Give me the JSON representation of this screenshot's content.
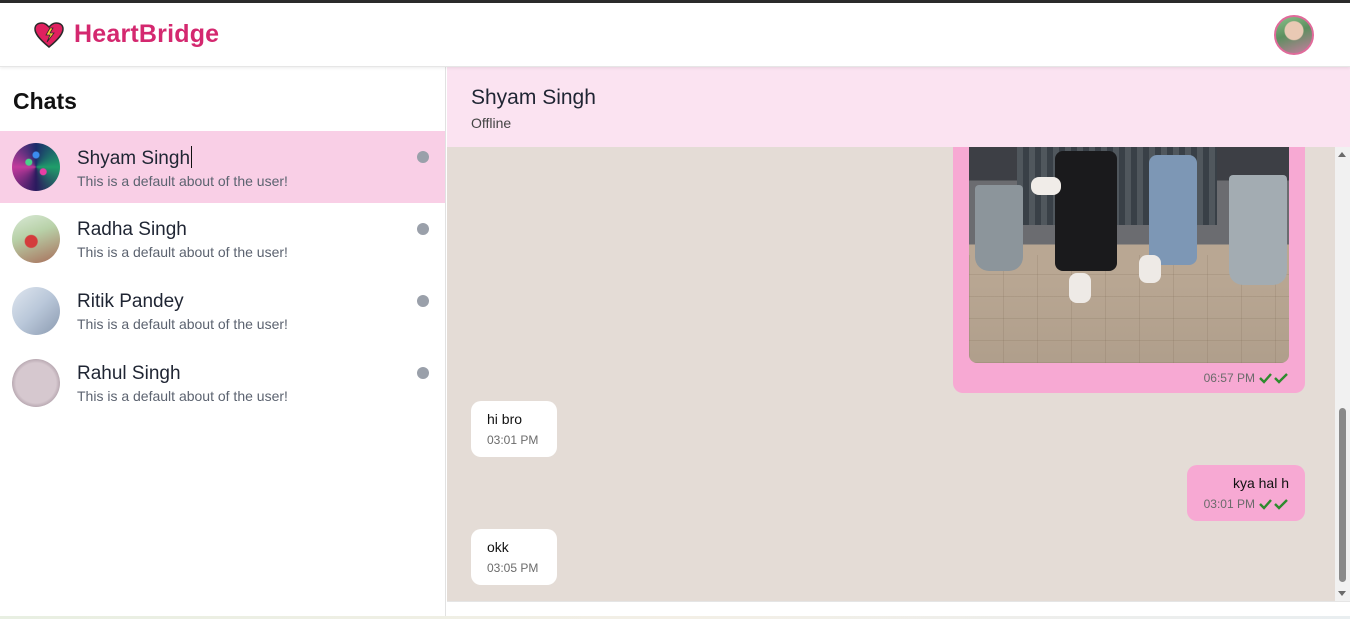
{
  "app": {
    "brand_name": "HeartBridge"
  },
  "sidebar": {
    "title": "Chats",
    "items": [
      {
        "name": "Shyam Singh",
        "about": "This is a default about of the user!",
        "active": true
      },
      {
        "name": "Radha Singh",
        "about": "This is a default about of the user!",
        "active": false
      },
      {
        "name": "Ritik Pandey",
        "about": "This is a default about of the user!",
        "active": false
      },
      {
        "name": "Rahul Singh",
        "about": "This is a default about of the user!",
        "active": false
      }
    ]
  },
  "chat": {
    "contact_name": "Shyam Singh",
    "contact_status": "Offline",
    "messages": [
      {
        "direction": "out",
        "type": "image",
        "time": "06:57 PM",
        "read": true
      },
      {
        "direction": "in",
        "type": "text",
        "text": "hi bro",
        "time": "03:01 PM"
      },
      {
        "direction": "out",
        "type": "text",
        "text": "kya hal h",
        "time": "03:01 PM",
        "read": true
      },
      {
        "direction": "in",
        "type": "text",
        "text": "okk",
        "time": "03:05 PM"
      }
    ]
  },
  "colors": {
    "brand": "#d4286f",
    "active_chat": "#f9cfe6",
    "header_bg": "#fbe3f1",
    "chat_bg": "#e4dcd6",
    "outgoing_bubble": "#f7a9d3",
    "read_tick": "#2e8b2e",
    "status_dot": "#9aa0aa"
  }
}
